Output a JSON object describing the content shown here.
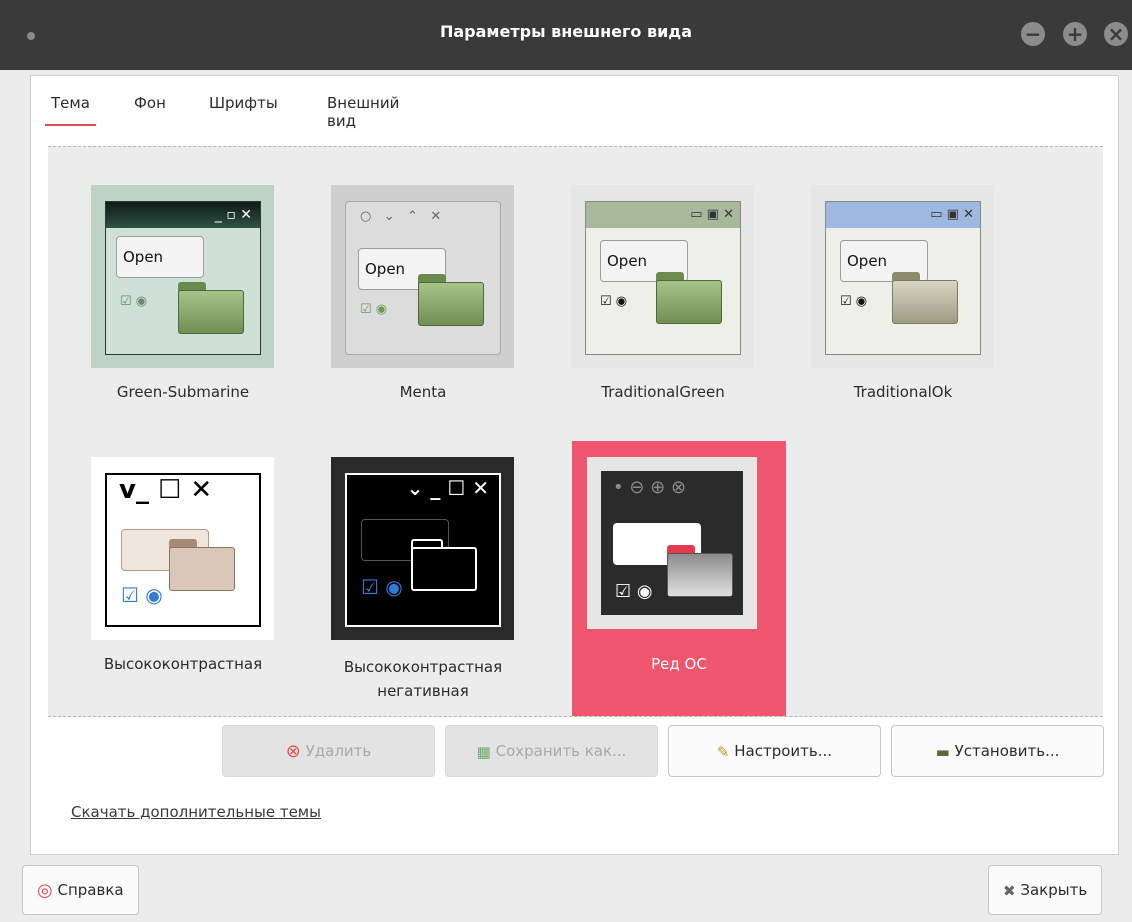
{
  "window": {
    "title": "Параметры внешнего вида"
  },
  "tabs": [
    {
      "label": "Тема",
      "active": true
    },
    {
      "label": "Фон",
      "active": false
    },
    {
      "label": "Шрифты",
      "active": false
    },
    {
      "label": "Внешний вид",
      "active": false
    }
  ],
  "themes": [
    {
      "name": "Green-Submarine"
    },
    {
      "name": "Menta"
    },
    {
      "name": "TraditionalGreen"
    },
    {
      "name": "TraditionalOk"
    },
    {
      "name": "Высококонтрастная"
    },
    {
      "name": "Высококонтрастная негативная"
    },
    {
      "name": "Ред ОС",
      "selected": true
    }
  ],
  "preview": {
    "open_label": "Open"
  },
  "buttons": {
    "delete": "Удалить",
    "save_as": "Сохранить как...",
    "customize": "Настроить...",
    "install": "Установить..."
  },
  "link": {
    "more_themes": "Скачать дополнительные темы"
  },
  "footer": {
    "help": "Справка",
    "close": "Закрыть"
  },
  "colors": {
    "accent": "#f0566e",
    "titlebar": "#3a3a3a",
    "tab_underline": "#e04b4b"
  }
}
